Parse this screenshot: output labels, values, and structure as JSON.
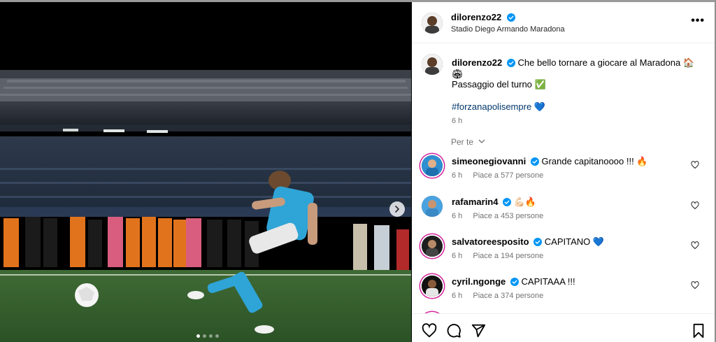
{
  "post": {
    "author": "dilorenzo22",
    "location": "Stadio Diego Armando Maradona",
    "caption_line1": "Che bello tornare a giocare al Maradona 🏠🏟",
    "caption_line2": "Passaggio del turno ✅",
    "caption_hashtag": "#forzanapolisempre",
    "caption_emoji": "💙",
    "caption_time": "6 h",
    "more_label": "•••"
  },
  "filter_label": "Per te",
  "comments": [
    {
      "user": "simeonegiovanni",
      "text": "Grande capitanoooo !!! 🔥",
      "time": "6 h",
      "likes": "Piace a 577 persone"
    },
    {
      "user": "rafamarin4",
      "text": "💪🏻🔥",
      "time": "6 h",
      "likes": "Piace a 453 persone"
    },
    {
      "user": "salvatoreesposito",
      "text": "CAPITANO 💙",
      "time": "6 h",
      "likes": "Piace a 194 persone"
    },
    {
      "user": "cyril.ngonge",
      "text": "CAPITAAA !!!",
      "time": "6 h",
      "likes": "Piace a 374 persone"
    }
  ],
  "carousel": {
    "total_dots": 4,
    "active_index": 0
  },
  "colors": {
    "verified": "#0095f6",
    "hashtag": "#00376b",
    "meta": "#737373",
    "story_ring": "#d6249f"
  },
  "icons": {
    "like": "heart-icon",
    "comment": "comment-icon",
    "share": "share-icon",
    "save": "bookmark-icon",
    "next": "chevron-right-icon"
  }
}
